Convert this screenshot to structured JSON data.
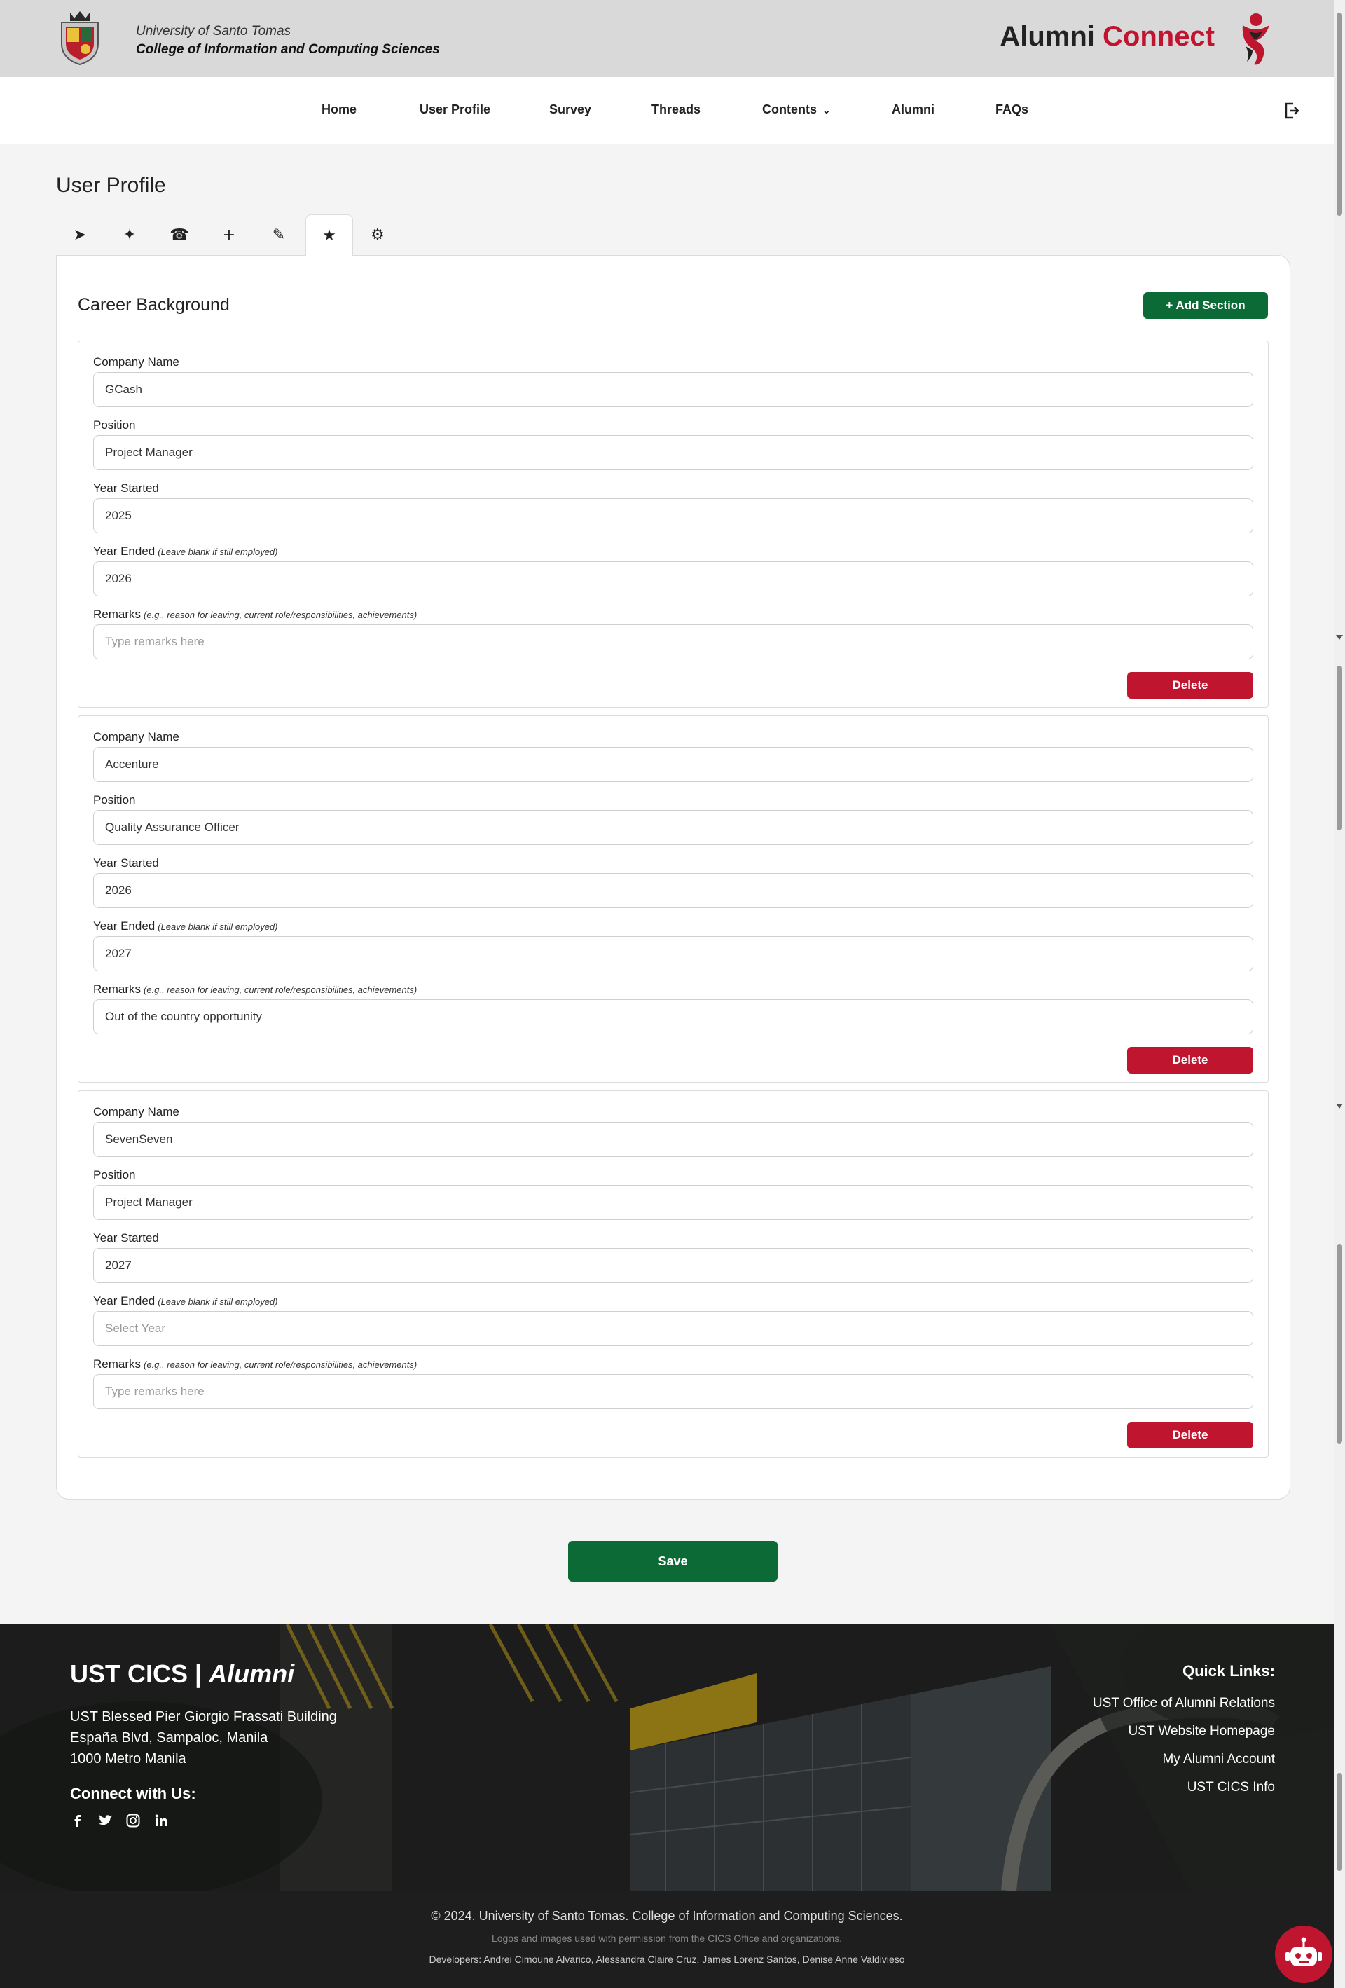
{
  "header": {
    "university": "University of Santo Tomas",
    "college": "College of Information and Computing Sciences",
    "brand_main": "Alumni",
    "brand_accent": "Connect"
  },
  "nav": {
    "items": [
      "Home",
      "User Profile",
      "Survey",
      "Threads",
      "Contents",
      "Alumni",
      "FAQs"
    ]
  },
  "page": {
    "title": "User Profile",
    "tabs": [
      {
        "icon": "send-icon",
        "glyph": "➤"
      },
      {
        "icon": "sparkle-icon",
        "glyph": "✦"
      },
      {
        "icon": "phone-icon",
        "glyph": "☎"
      },
      {
        "icon": "plus-icon",
        "glyph": "+"
      },
      {
        "icon": "pencil-icon",
        "glyph": "✎"
      },
      {
        "icon": "star-icon",
        "glyph": "★"
      },
      {
        "icon": "settings-icon",
        "glyph": "⚙"
      }
    ],
    "active_tab": 5
  },
  "career": {
    "title": "Career Background",
    "add_label": "+ Add Section",
    "labels": {
      "company": "Company Name",
      "position": "Position",
      "year_started": "Year Started",
      "year_ended": "Year Ended",
      "year_ended_hint": "(Leave blank if still employed)",
      "remarks": "Remarks",
      "remarks_hint": "(e.g., reason for leaving, current role/responsibilities, achievements)"
    },
    "placeholders": {
      "remarks": "Type remarks here",
      "year_ended": "Select Year"
    },
    "delete_label": "Delete",
    "sections": [
      {
        "company": "GCash",
        "position": "Project Manager",
        "year_started": "2025",
        "year_ended": "2026",
        "remarks": ""
      },
      {
        "company": "Accenture",
        "position": "Quality Assurance Officer",
        "year_started": "2026",
        "year_ended": "2027",
        "remarks": "Out of the country opportunity"
      },
      {
        "company": "SevenSeven",
        "position": "Project Manager",
        "year_started": "2027",
        "year_ended": "",
        "remarks": ""
      }
    ]
  },
  "save_label": "Save",
  "footer": {
    "brand_main": "UST CICS |",
    "brand_italic": "Alumni",
    "address": [
      "UST Blessed Pier Giorgio Frassati Building",
      "España Blvd, Sampaloc, Manila",
      "1000 Metro Manila"
    ],
    "connect_title": "Connect with Us:",
    "social": [
      "facebook-icon",
      "twitter-icon",
      "instagram-icon",
      "linkedin-icon"
    ],
    "quick_links_title": "Quick Links:",
    "quick_links": [
      "UST Office of Alumni Relations",
      "UST Website Homepage",
      "My Alumni Account",
      "UST CICS Info"
    ],
    "copyright": "© 2024. University of Santo Tomas. College of Information and Computing Sciences.",
    "permission": "Logos and images used with permission from the CICS Office and organizations.",
    "developers": "Developers: Andrei Cimoune Alvarico, Alessandra Claire Cruz, James Lorenz Santos, Denise Anne Valdivieso"
  },
  "colors": {
    "accent_red": "#c0152f",
    "accent_green": "#0b6a36"
  }
}
